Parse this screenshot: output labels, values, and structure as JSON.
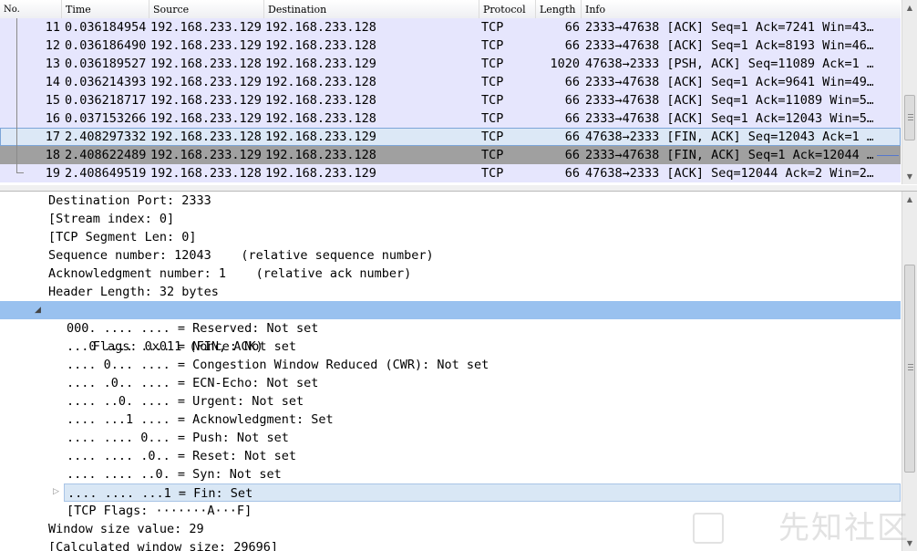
{
  "packet_list": {
    "columns": {
      "no": "No.",
      "time": "Time",
      "source": "Source",
      "destination": "Destination",
      "protocol": "Protocol",
      "length": "Length",
      "info": "Info"
    },
    "rows": [
      {
        "no": "11",
        "time": "0.036184954",
        "source": "192.168.233.129",
        "destination": "192.168.233.128",
        "protocol": "TCP",
        "length": "66",
        "info": "2333→47638 [ACK] Seq=1 Ack=7241 Win=43…"
      },
      {
        "no": "12",
        "time": "0.036186490",
        "source": "192.168.233.129",
        "destination": "192.168.233.128",
        "protocol": "TCP",
        "length": "66",
        "info": "2333→47638 [ACK] Seq=1 Ack=8193 Win=46…"
      },
      {
        "no": "13",
        "time": "0.036189527",
        "source": "192.168.233.128",
        "destination": "192.168.233.129",
        "protocol": "TCP",
        "length": "1020",
        "info": "47638→2333 [PSH, ACK] Seq=11089 Ack=1 …"
      },
      {
        "no": "14",
        "time": "0.036214393",
        "source": "192.168.233.129",
        "destination": "192.168.233.128",
        "protocol": "TCP",
        "length": "66",
        "info": "2333→47638 [ACK] Seq=1 Ack=9641 Win=49…"
      },
      {
        "no": "15",
        "time": "0.036218717",
        "source": "192.168.233.129",
        "destination": "192.168.233.128",
        "protocol": "TCP",
        "length": "66",
        "info": "2333→47638 [ACK] Seq=1 Ack=11089 Win=5…"
      },
      {
        "no": "16",
        "time": "0.037153266",
        "source": "192.168.233.129",
        "destination": "192.168.233.128",
        "protocol": "TCP",
        "length": "66",
        "info": "2333→47638 [ACK] Seq=1 Ack=12043 Win=5…"
      },
      {
        "no": "17",
        "time": "2.408297332",
        "source": "192.168.233.128",
        "destination": "192.168.233.129",
        "protocol": "TCP",
        "length": "66",
        "info": "47638→2333 [FIN, ACK] Seq=12043 Ack=1 …"
      },
      {
        "no": "18",
        "time": "2.408622489",
        "source": "192.168.233.129",
        "destination": "192.168.233.128",
        "protocol": "TCP",
        "length": "66",
        "info": "2333→47638 [FIN, ACK] Seq=1 Ack=12044 …"
      },
      {
        "no": "19",
        "time": "2.408649519",
        "source": "192.168.233.128",
        "destination": "192.168.233.129",
        "protocol": "TCP",
        "length": "66",
        "info": "47638→2333 [ACK] Seq=12044 Ack=2 Win=2…"
      }
    ]
  },
  "details": {
    "lines": [
      "Destination Port: 2333",
      "[Stream index: 0]",
      "[TCP Segment Len: 0]",
      "Sequence number: 12043    (relative sequence number)",
      "Acknowledgment number: 1    (relative ack number)",
      "Header Length: 32 bytes",
      "Flags: 0x011 (FIN, ACK)",
      "000. .... .... = Reserved: Not set",
      "...0 .... .... = Nonce: Not set",
      ".... 0... .... = Congestion Window Reduced (CWR): Not set",
      ".... .0.. .... = ECN-Echo: Not set",
      ".... ..0. .... = Urgent: Not set",
      ".... ...1 .... = Acknowledgment: Set",
      ".... .... 0... = Push: Not set",
      ".... .... .0.. = Reset: Not set",
      ".... .... ..0. = Syn: Not set",
      ".... .... ...1 = Fin: Set",
      "[TCP Flags: ·······A···F]",
      "Window size value: 29",
      "[Calculated window size: 29696]"
    ]
  },
  "watermark": "先知社区",
  "colors": {
    "row_bg": "#e6e6fd",
    "selected_row_bg": "#dce8f6",
    "fin_row_bg": "#a0a0a0",
    "flags_highlight": "#99c1ef",
    "fin_line_highlight": "#d9e7f5"
  }
}
